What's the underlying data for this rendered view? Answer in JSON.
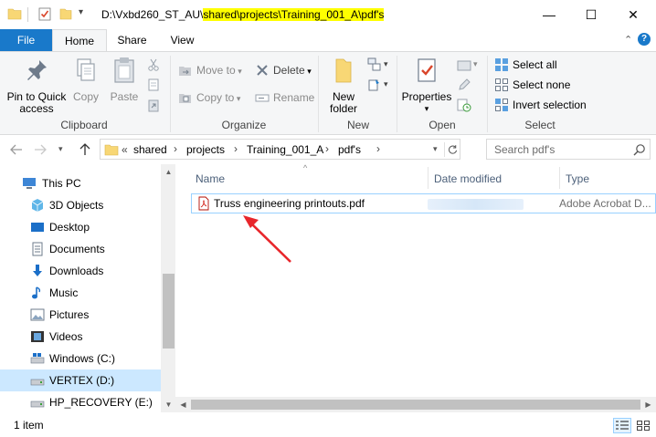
{
  "window": {
    "title_prefix": "D:\\Vxbd260_ST_AU\\",
    "title_highlight": "shared\\projects\\Training_001_A\\pdf's",
    "minimize": "—",
    "maximize": "☐",
    "close": "✕"
  },
  "ribbon_tabs": {
    "file": "File",
    "home": "Home",
    "share": "Share",
    "view": "View"
  },
  "ribbon_right": {
    "collapse": "⌃",
    "help": "?"
  },
  "ribbon": {
    "clipboard": {
      "label": "Clipboard",
      "pin_line1": "Pin to Quick",
      "pin_line2": "access",
      "copy": "Copy",
      "paste": "Paste"
    },
    "organize": {
      "label": "Organize",
      "move_to": "Move to",
      "copy_to": "Copy to",
      "delete": "Delete",
      "rename": "Rename"
    },
    "new": {
      "label": "New",
      "new_folder_line1": "New",
      "new_folder_line2": "folder"
    },
    "open": {
      "label": "Open",
      "properties": "Properties"
    },
    "select": {
      "label": "Select",
      "select_all": "Select all",
      "select_none": "Select none",
      "invert_selection": "Invert selection"
    }
  },
  "address": {
    "overflow": "«",
    "crumbs": [
      "shared",
      "projects",
      "Training_001_A",
      "pdf's"
    ],
    "search_placeholder": "Search pdf's"
  },
  "nav_pane": {
    "items": [
      {
        "label": "This PC",
        "icon": "pc-icon"
      },
      {
        "label": "3D Objects",
        "icon": "3d-objects-icon"
      },
      {
        "label": "Desktop",
        "icon": "desktop-icon"
      },
      {
        "label": "Documents",
        "icon": "documents-icon"
      },
      {
        "label": "Downloads",
        "icon": "downloads-icon"
      },
      {
        "label": "Music",
        "icon": "music-icon"
      },
      {
        "label": "Pictures",
        "icon": "pictures-icon"
      },
      {
        "label": "Videos",
        "icon": "videos-icon"
      },
      {
        "label": "Windows (C:)",
        "icon": "drive-c-icon"
      },
      {
        "label": "VERTEX (D:)",
        "icon": "drive-d-icon",
        "selected": true
      },
      {
        "label": "HP_RECOVERY (E:)",
        "icon": "drive-e-icon"
      }
    ]
  },
  "columns": {
    "name": "Name",
    "date_modified": "Date modified",
    "type": "Type"
  },
  "files": [
    {
      "name": "Truss engineering printouts.pdf",
      "type": "Adobe Acrobat D..."
    }
  ],
  "status": {
    "count": "1 item"
  },
  "colors": {
    "accent": "#1979ca",
    "highlight": "#ffff00",
    "selection": "#cce8ff",
    "annotation_arrow": "#e8262b"
  }
}
